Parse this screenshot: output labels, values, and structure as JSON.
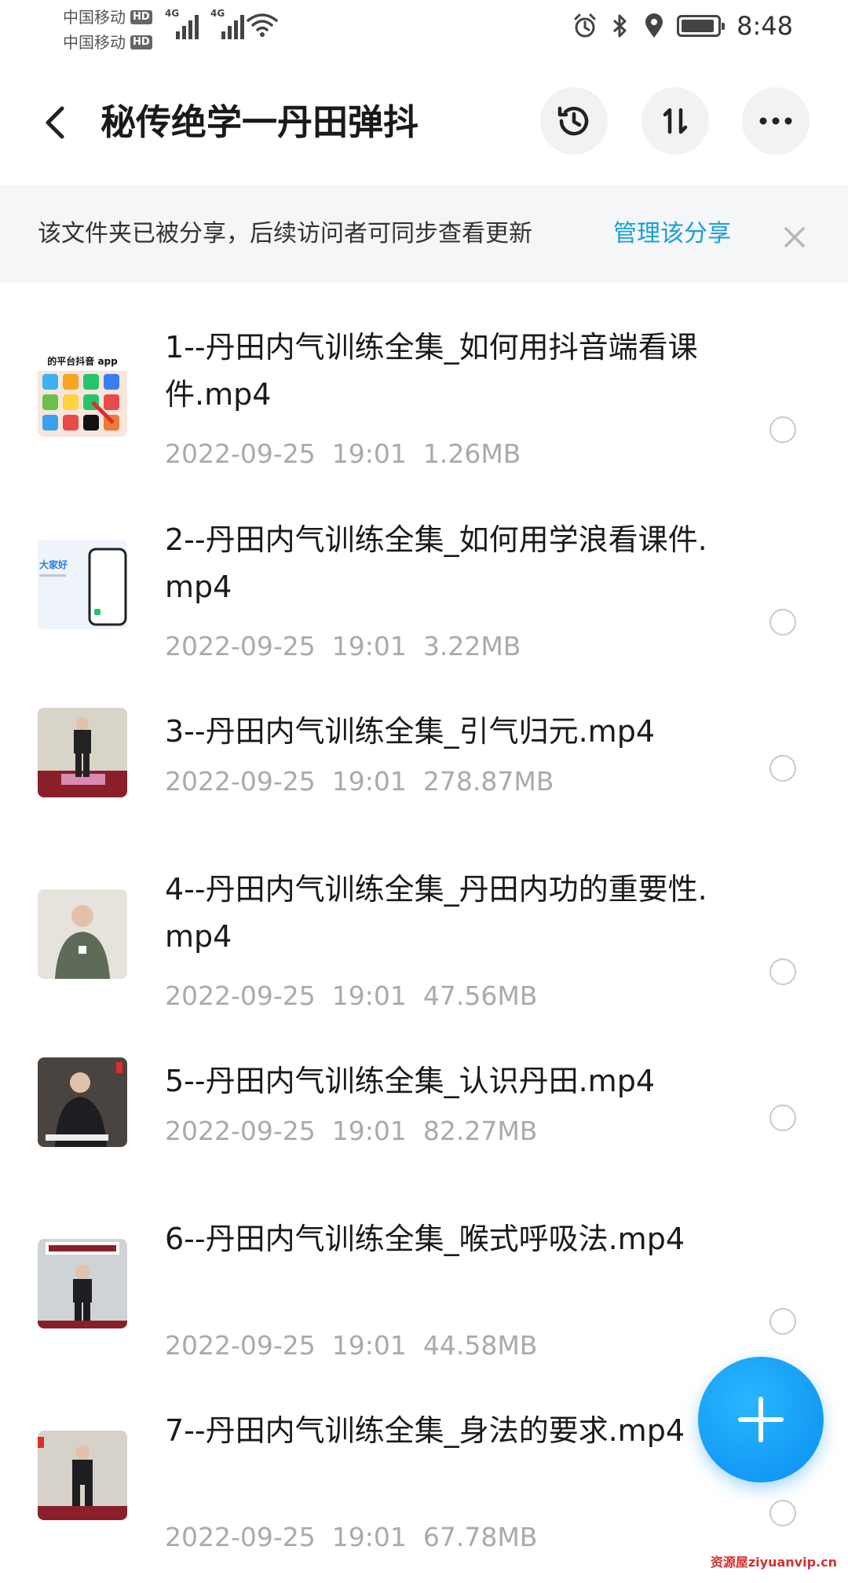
{
  "status_bar": {
    "carrier1": "中国移动",
    "carrier2": "中国移动",
    "hd": "HD",
    "net1": "4G",
    "net2": "4G",
    "time": "8:48",
    "icons": [
      "alarm-icon",
      "bluetooth-icon",
      "location-icon",
      "battery-icon"
    ]
  },
  "header": {
    "title": "秘传绝学一丹田弹抖",
    "back_icon": "chevron-left-icon",
    "buttons": [
      "history-icon",
      "sort-icon",
      "more-icon"
    ]
  },
  "banner": {
    "text": "该文件夹已被分享，后续访问者可同步查看更新",
    "link": "管理该分享",
    "close_icon": "close-icon"
  },
  "files": [
    {
      "name": "1--丹田内气训练全集_如何用抖音端看课件.mp4",
      "date": "2022-09-25",
      "time": "19:01",
      "size": "1.26MB"
    },
    {
      "name": "2--丹田内气训练全集_如何用学浪看课件.mp4",
      "date": "2022-09-25",
      "time": "19:01",
      "size": "3.22MB"
    },
    {
      "name": "3--丹田内气训练全集_引气归元.mp4",
      "date": "2022-09-25",
      "time": "19:01",
      "size": "278.87MB"
    },
    {
      "name": "4--丹田内气训练全集_丹田内功的重要性.mp4",
      "date": "2022-09-25",
      "time": "19:01",
      "size": "47.56MB"
    },
    {
      "name": "5--丹田内气训练全集_认识丹田.mp4",
      "date": "2022-09-25",
      "time": "19:01",
      "size": "82.27MB"
    },
    {
      "name": "6--丹田内气训练全集_喉式呼吸法.mp4",
      "date": "2022-09-25",
      "time": "19:01",
      "size": "44.58MB"
    },
    {
      "name": "7--丹田内气训练全集_身法的要求.mp4",
      "date": "2022-09-25",
      "time": "19:01",
      "size": "67.78MB"
    }
  ],
  "thumb_texts": {
    "thumb1_caption": "的平台抖音 app",
    "thumb2_caption": "大家好"
  },
  "fab": {
    "icon": "plus-icon"
  },
  "watermark": "资源屋ziyuanvip.cn",
  "colors": {
    "accent": "#1a9fd6",
    "fab": "#0a8ff0",
    "meta": "#aaaaaa"
  }
}
